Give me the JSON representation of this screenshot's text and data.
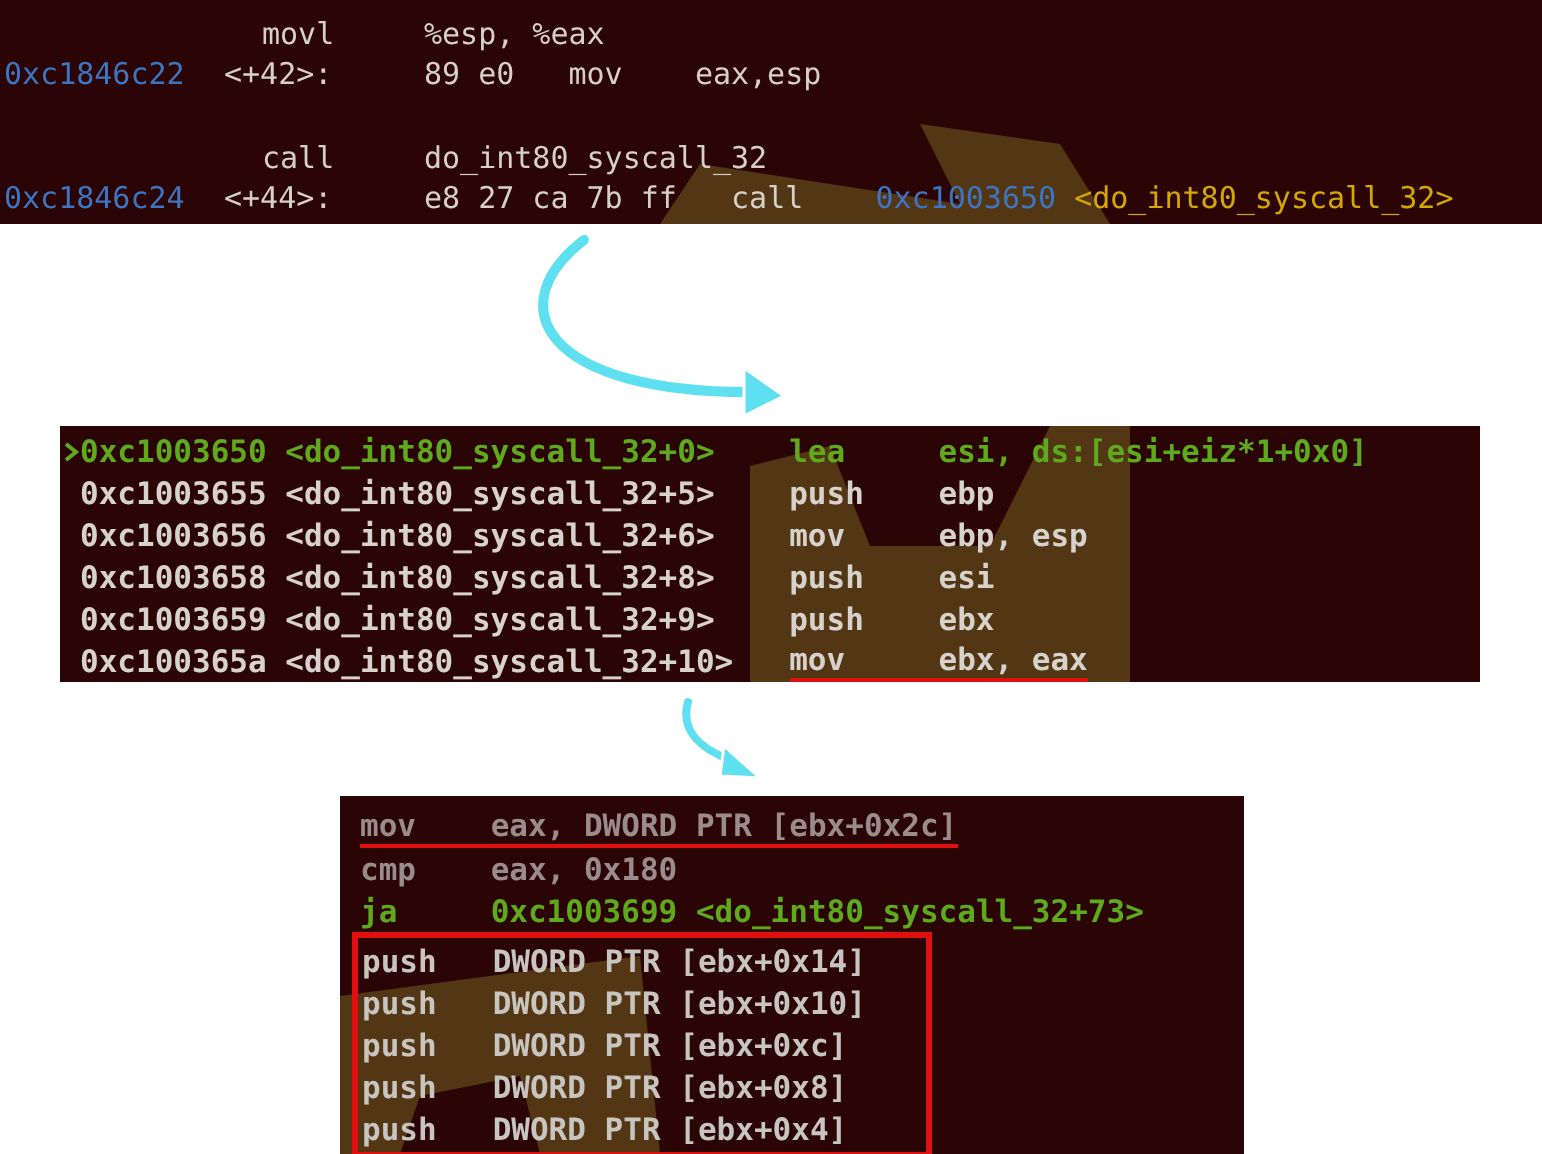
{
  "panel1": {
    "lines": [
      {
        "kind": "source",
        "mnemonic": "movl",
        "operands": "%esp, %eax"
      },
      {
        "kind": "disasm",
        "address": "0xc1846c22",
        "offset": "<+42>:",
        "bytes": "89 e0",
        "mnemonic": "mov",
        "operands": "eax,esp"
      },
      {
        "kind": "source",
        "mnemonic": "call",
        "operands": "do_int80_syscall_32"
      },
      {
        "kind": "disasm",
        "address": "0xc1846c24",
        "offset": "<+44>:",
        "bytes": "e8 27 ca 7b ff",
        "mnemonic": "call",
        "target_address": "0xc1003650",
        "target_symbol": "<do_int80_syscall_32>"
      }
    ]
  },
  "panel2": {
    "lines": [
      {
        "current": true,
        "underlined": false,
        "address": "0xc1003650",
        "symbol": "<do_int80_syscall_32+0>",
        "mnemonic": "lea",
        "operands": "esi, ds:[esi+eiz*1+0x0]"
      },
      {
        "current": false,
        "underlined": false,
        "address": "0xc1003655",
        "symbol": "<do_int80_syscall_32+5>",
        "mnemonic": "push",
        "operands": "ebp"
      },
      {
        "current": false,
        "underlined": false,
        "address": "0xc1003656",
        "symbol": "<do_int80_syscall_32+6>",
        "mnemonic": "mov",
        "operands": "ebp, esp"
      },
      {
        "current": false,
        "underlined": false,
        "address": "0xc1003658",
        "symbol": "<do_int80_syscall_32+8>",
        "mnemonic": "push",
        "operands": "esi"
      },
      {
        "current": false,
        "underlined": false,
        "address": "0xc1003659",
        "symbol": "<do_int80_syscall_32+9>",
        "mnemonic": "push",
        "operands": "ebx"
      },
      {
        "current": false,
        "underlined": true,
        "address": "0xc100365a",
        "symbol": "<do_int80_syscall_32+10>",
        "mnemonic": "mov",
        "operands": "ebx, eax"
      }
    ]
  },
  "panel3": {
    "lines": [
      {
        "kind": "plain",
        "underlined": true,
        "mnemonic": "mov",
        "operands": "eax, DWORD PTR [ebx+0x2c]"
      },
      {
        "kind": "plain",
        "underlined": false,
        "mnemonic": "cmp",
        "operands": "eax, 0x180"
      },
      {
        "kind": "jump",
        "underlined": false,
        "mnemonic": "ja",
        "operands": "0xc1003699 <do_int80_syscall_32+73>"
      }
    ],
    "highlight_box": {
      "lines": [
        {
          "kind": "push",
          "underlined": false,
          "mnemonic": "push",
          "operands": "DWORD PTR [ebx+0x14]"
        },
        {
          "kind": "push",
          "underlined": false,
          "mnemonic": "push",
          "operands": "DWORD PTR [ebx+0x10]"
        },
        {
          "kind": "push",
          "underlined": false,
          "mnemonic": "push",
          "operands": "DWORD PTR [ebx+0xc]"
        },
        {
          "kind": "push",
          "underlined": false,
          "mnemonic": "push",
          "operands": "DWORD PTR [ebx+0x8]"
        },
        {
          "kind": "push",
          "underlined": false,
          "mnemonic": "push",
          "operands": "DWORD PTR [ebx+0x4]"
        }
      ]
    }
  }
}
